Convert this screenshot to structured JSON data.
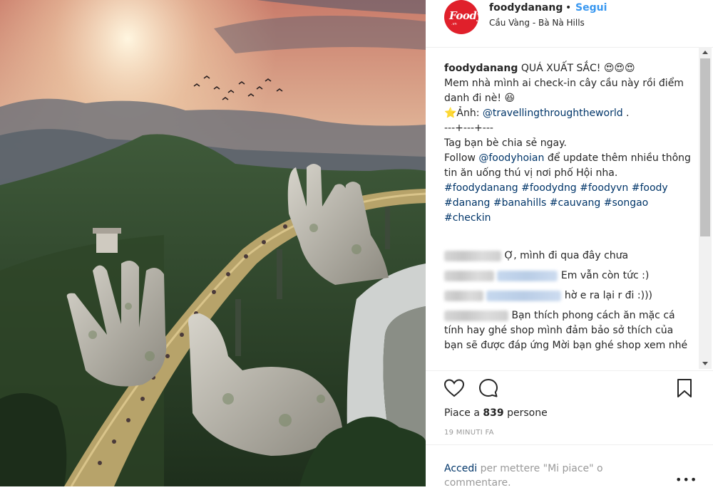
{
  "post": {
    "username": "foodydanang",
    "dot": "•",
    "follow_label": "Segui",
    "location": "Cầu Vàng - Bà Nà Hills",
    "avatar_text": "Foody",
    "avatar_sub": ".vn"
  },
  "caption": {
    "username": "foodydanang",
    "line1": "QUÁ XUẤT SẮC! 😍😍😍",
    "line2": "Mem nhà mình ai check-in cây cầu này rồi điểm danh đi nè! 😆",
    "photo_prefix": "⭐Ảnh: ",
    "photo_credit": "@travellingthroughtheworld",
    "photo_suffix": " .",
    "separator": "---+---+---",
    "tag_line": "Tag bạn bè chia sẻ ngay.",
    "follow_prefix": "Follow ",
    "follow_mention": "@foodyhoian",
    "follow_suffix": " để update thêm nhiều thông tin ăn uống thú vị nơi phố Hội nha.",
    "hashtags": "#foodydanang #foodydng #foodyvn #foody #danang #banahills #cauvang #songao #checkin"
  },
  "comments": [
    {
      "text": "Ợ, mình đi qua đây chưa"
    },
    {
      "text": "Em vẫn còn tức :)"
    },
    {
      "text": "hờ e ra lại r đi :)))"
    },
    {
      "text": "Bạn thích phong cách ăn mặc cá tính hay ghé shop mình đảm bảo sở thích của bạn sẽ được đáp ứng Mời bạn ghé shop xem nhé"
    }
  ],
  "stats": {
    "likes_prefix": "Piace a ",
    "likes_count": "839",
    "likes_suffix": " persone",
    "timestamp": "19 MINUTI FA"
  },
  "login": {
    "link": "Accedi",
    "text": " per mettere \"Mi piace\" o commentare."
  },
  "more_label": "•••",
  "icons": {
    "like": "heart-icon",
    "comment": "comment-icon",
    "save": "bookmark-icon"
  },
  "colors": {
    "link": "#3897f0",
    "mention": "#003569",
    "brand": "#e0202b"
  }
}
